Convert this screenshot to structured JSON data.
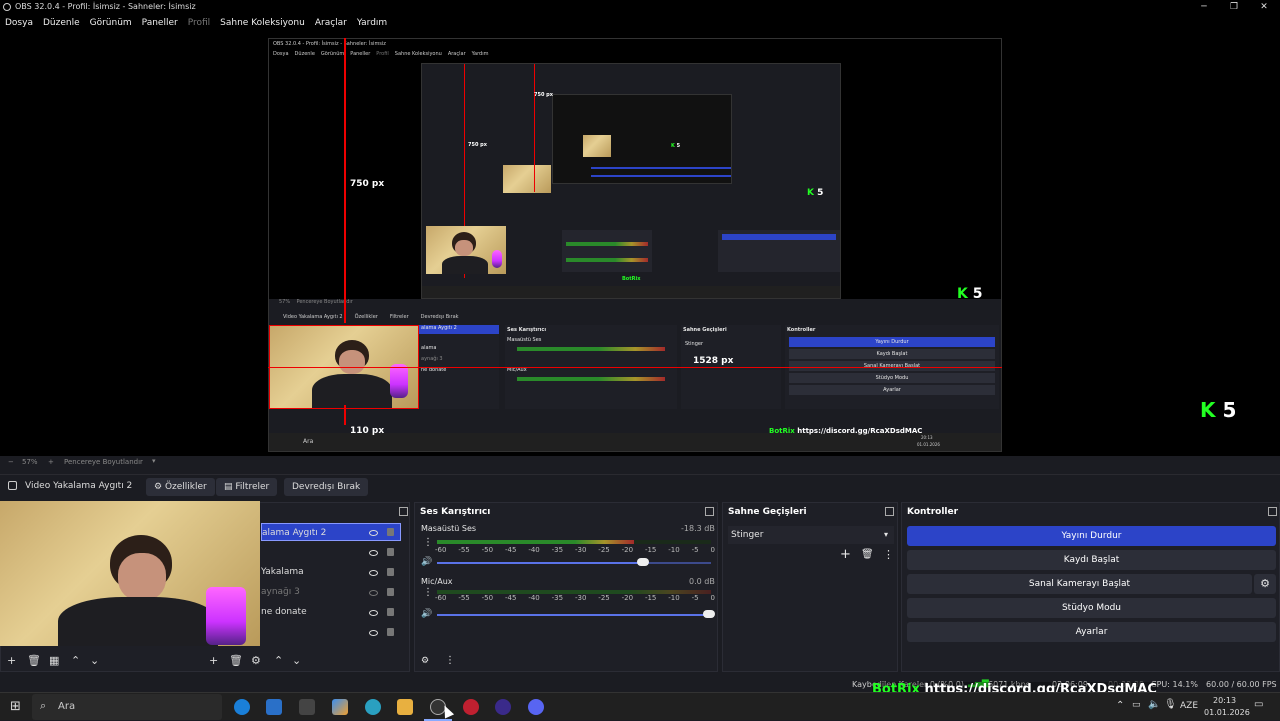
{
  "window": {
    "title": "OBS 32.0.4 - Profil: İsimsiz - Sahneler: İsimsiz"
  },
  "menu": [
    "Dosya",
    "Düzenle",
    "Görünüm",
    "Paneller",
    "Profil",
    "Sahne Koleksiyonu",
    "Araçlar",
    "Yardım"
  ],
  "preview": {
    "label_750": "750 px",
    "label_110_outer": "110 px",
    "label_1528": "1528 px",
    "label_110_inner": "110 px",
    "label_750_inner": "750 px",
    "k5": "5",
    "k5_inner": "5",
    "k5_inner2": "5",
    "inner_title": "OBS 32.0.4 - Profil: İsimsiz - Sahneler: İsimsiz",
    "inner_menu": [
      "Dosya",
      "Düzenle",
      "Görünüm",
      "Paneller",
      "Profil",
      "Sahne Koleksiyonu",
      "Araçlar",
      "Yardım"
    ],
    "inner_zoom": "57%",
    "inner_fit": "Pencereye Boyutlandır",
    "inner_source": "Video Yakalama Aygıtı 2",
    "inner_props": "Özellikler",
    "inner_filters": "Filtreler",
    "inner_deact": "Devredışı Bırak",
    "inner_mixer": "Ses Karıştırıcı",
    "inner_trans": "Sahne Geçişleri",
    "inner_ctrl": "Kontroller",
    "inner_stinger": "Stinger",
    "inner_desktop": "Masaüstü Ses",
    "inner_mic": "Mic/Aux",
    "inner_buttons": [
      "Yayını Durdur",
      "Kaydı Başlat",
      "Sanal Kamerayı Başlat",
      "Stüdyo Modu",
      "Ayarlar"
    ],
    "inner_sources": [
      "alama Aygıtı 2",
      "",
      "alama",
      "aynağı 3",
      "ne donate"
    ],
    "inner_discord": "https://discord.gg/RcaXDsdMAC",
    "inner_botrix": "BotRix",
    "inner_search": "Ara",
    "inner_time": "20:13",
    "inner_date": "01.01.2026"
  },
  "zoom": {
    "percent": "57%",
    "fit_label": "Pencereye Boyutlandır"
  },
  "source_toolbar": {
    "source_name": "Video Yakalama Aygıtı 2",
    "properties": "Özellikler",
    "filters": "Filtreler",
    "deactivate": "Devredışı Bırak"
  },
  "sources": {
    "items": [
      {
        "label": "alama Aygıtı 2",
        "selected": true,
        "hidden": false
      },
      {
        "label": "",
        "selected": false,
        "hidden": false
      },
      {
        "label": "Yakalama",
        "selected": false,
        "hidden": false
      },
      {
        "label": "aynağı 3",
        "selected": false,
        "hidden": true
      },
      {
        "label": "ne donate",
        "selected": false,
        "hidden": false
      },
      {
        "label": "",
        "selected": false,
        "hidden": false
      }
    ]
  },
  "mixer": {
    "title": "Ses Karıştırıcı",
    "ticks": [
      "-60",
      "-55",
      "-50",
      "-45",
      "-40",
      "-35",
      "-30",
      "-25",
      "-20",
      "-15",
      "-10",
      "-5",
      "0"
    ],
    "channels": [
      {
        "name": "Masaüstü Ses",
        "db": "-18.3 dB",
        "level": 0.72,
        "volume": 0.76
      },
      {
        "name": "Mic/Aux",
        "db": "0.0 dB",
        "level": 0.0,
        "volume": 1.0
      }
    ]
  },
  "transitions": {
    "title": "Sahne Geçişleri",
    "selected": "Stinger"
  },
  "controls": {
    "title": "Kontroller",
    "buttons": [
      "Yayını Durdur",
      "Kaydı Başlat",
      "Sanal Kamerayı Başlat",
      "Stüdyo Modu",
      "Ayarlar"
    ]
  },
  "status": {
    "dropped": "Kaybedilen Kareler 0 (%0.0)",
    "bitrate": "6071 kbps",
    "live_time": "02:06:09",
    "rec_time": "00:00:00",
    "cpu": "CPU: 14.1%",
    "fps": "60.00 / 60.00 FPS",
    "botrix": "BotRix",
    "discord": "https://discord.gg/RcaXDsdMAC"
  },
  "taskbar": {
    "search": "Ara",
    "lang": "AZE",
    "time": "20:13",
    "date": "01.01.2026"
  },
  "colors": {
    "accent": "#2c44c8",
    "red_guide": "#e00000",
    "meter_green": "#2a8a2a",
    "meter_yellow": "#a6942a",
    "meter_red": "#a32a2a"
  }
}
